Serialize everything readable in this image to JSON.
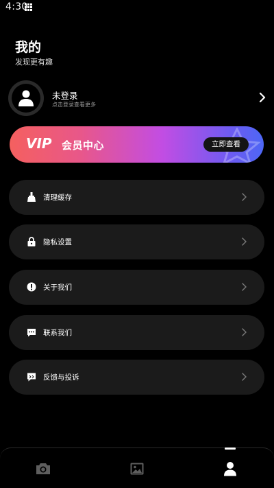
{
  "status_bar": {
    "time": "4:30",
    "grid_icon": "app-grid-icon"
  },
  "header": {
    "title": "我的",
    "subtitle": "发现更有趣"
  },
  "profile": {
    "login_status": "未登录",
    "login_hint": "点击登录查看更多",
    "avatar_icon": "user-icon"
  },
  "vip": {
    "logo": "VIP",
    "title": "会员中心",
    "button_label": "立即查看"
  },
  "menu": {
    "items": [
      {
        "label": "清理缓存",
        "icon": "broom-icon"
      },
      {
        "label": "隐私设置",
        "icon": "lock-icon"
      },
      {
        "label": "关于我们",
        "icon": "info-icon"
      },
      {
        "label": "联系我们",
        "icon": "chat-icon"
      },
      {
        "label": "反馈与投诉",
        "icon": "feedback-icon"
      }
    ]
  },
  "bottom_nav": {
    "tabs": [
      {
        "name": "camera",
        "icon": "camera-icon",
        "active": false
      },
      {
        "name": "gallery",
        "icon": "image-icon",
        "active": false
      },
      {
        "name": "profile",
        "icon": "user-icon",
        "active": true
      }
    ]
  },
  "colors": {
    "background": "#000000",
    "card": "#1b1b1b",
    "vip_gradient_start": "#f5605f",
    "vip_gradient_mid": "#c24de3",
    "vip_gradient_end": "#4d67f5"
  }
}
